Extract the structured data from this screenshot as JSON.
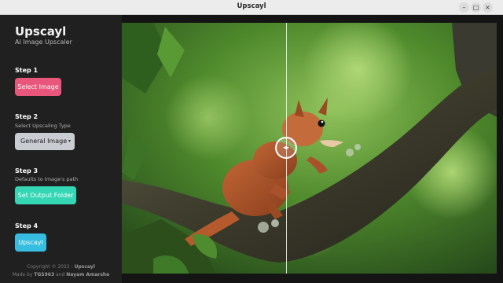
{
  "window": {
    "title": "Upscayl",
    "minimize_glyph": "–",
    "maximize_glyph": "□",
    "close_glyph": "×"
  },
  "sidebar": {
    "app_name": "Upscayl",
    "app_subtitle": "AI Image Upscaler",
    "steps": [
      {
        "title": "Step 1",
        "description": "",
        "control": "Select Image"
      },
      {
        "title": "Step 2",
        "description": "Select Upscaling Type",
        "control": "General Image"
      },
      {
        "title": "Step 3",
        "description": "Defaults to Image's path",
        "control": "Set Output Folder"
      },
      {
        "title": "Step 4",
        "description": "",
        "control": "Upscayl"
      }
    ],
    "footer": {
      "copyright_prefix": "Copyright © 2022 - ",
      "copyright_name": "Upscayl",
      "made_by_prefix": "Made by ",
      "author1": "TGS963",
      "and": " and ",
      "author2": "Nayam Amarshe"
    }
  },
  "viewer": {
    "compare_handle_glyph": "◂▸",
    "split_position": 0.44
  },
  "colors": {
    "select_image": "#e8567b",
    "set_output_folder": "#34d6b4",
    "upscayl": "#36bde0"
  }
}
